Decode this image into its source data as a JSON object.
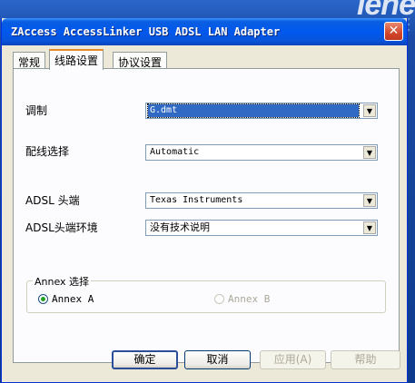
{
  "desktop": {
    "brand_text": "lene"
  },
  "window": {
    "title": "ZAccess AccessLinker USB ADSL LAN Adapter",
    "close_glyph": "✕"
  },
  "tabs": [
    {
      "label": "常规"
    },
    {
      "label": "线路设置"
    },
    {
      "label": "协议设置"
    }
  ],
  "form": {
    "modulation": {
      "label": "调制",
      "value": "G.dmt"
    },
    "wiring": {
      "label": "配线选择",
      "value": "Automatic"
    },
    "adsl_head": {
      "label": "ADSL 头端",
      "value": "Texas Instruments"
    },
    "adsl_env": {
      "label": "ADSL头端环境",
      "value": "没有技术说明"
    }
  },
  "annex": {
    "legend": "Annex 选择",
    "option_a": "Annex A",
    "option_b": "Annex B",
    "selected": "Annex A"
  },
  "buttons": {
    "ok": "确定",
    "cancel": "取消",
    "apply": "应用(A)",
    "help": "帮助"
  },
  "colors": {
    "titlebar": "#0058ee",
    "selection": "#316ac5",
    "active_tab_accent": "#e68b2c"
  }
}
